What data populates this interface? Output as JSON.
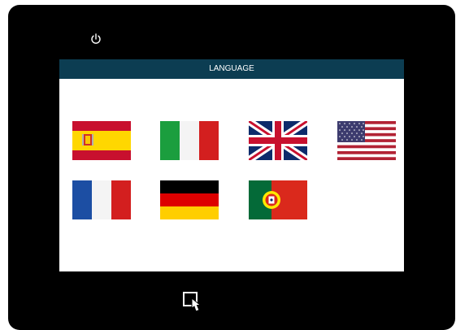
{
  "screen": {
    "title": "LANGUAGE"
  },
  "icons": {
    "power": "power-icon",
    "touch": "touch-screen-icon"
  },
  "flags": [
    {
      "name": "spanish-flag",
      "colors": [
        "#c8102e",
        "#ffd700"
      ]
    },
    {
      "name": "italian-flag",
      "colors": [
        "#1b9e3e",
        "#f4f4f4",
        "#d31f1f"
      ]
    },
    {
      "name": "uk-flag",
      "colors": [
        "#0d2b6b",
        "#ffffff",
        "#c8102e"
      ]
    },
    {
      "name": "us-flag",
      "colors": [
        "#b22234",
        "#ffffff",
        "#3c3b6e"
      ]
    },
    {
      "name": "french-flag",
      "colors": [
        "#1c4ea3",
        "#f4f4f4",
        "#d31f1f"
      ]
    },
    {
      "name": "german-flag",
      "colors": [
        "#000000",
        "#dd0000",
        "#ffce00"
      ]
    },
    {
      "name": "portuguese-flag",
      "colors": [
        "#046a38",
        "#da291c",
        "#ffe900"
      ]
    }
  ],
  "colors": {
    "titlebar": "#0c3d52",
    "bezel": "#000000",
    "screen": "#ffffff"
  }
}
